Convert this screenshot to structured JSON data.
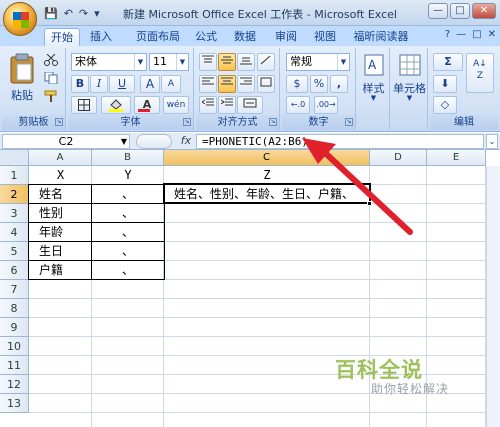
{
  "window": {
    "title": "新建 Microsoft Office Excel 工作表 - Microsoft Excel",
    "minimize": "—",
    "restore": "□",
    "close": "✕"
  },
  "qat": {
    "save": "💾",
    "undo": "↶",
    "redo": "↷",
    "customize": "▾"
  },
  "tabs": [
    "开始",
    "插入",
    "页面布局",
    "公式",
    "数据",
    "审阅",
    "视图",
    "福昕阅读器"
  ],
  "ribbon_right": {
    "help": "?",
    "min": "—",
    "restore": "□",
    "close": "✕"
  },
  "clipboard": {
    "paste": "粘贴",
    "label": "剪贴板"
  },
  "font": {
    "name": "宋体",
    "size": "11",
    "label": "字体",
    "bold": "B",
    "italic": "I",
    "underline": "U",
    "grow": "A",
    "shrink": "A",
    "phonetic": "wén"
  },
  "alignment": {
    "label": "对齐方式"
  },
  "number": {
    "format": "常规",
    "label": "数字",
    "percent": "%",
    "comma": ",",
    "currency": "$"
  },
  "styles": {
    "label": "样式"
  },
  "cells": {
    "label": "单元格"
  },
  "editing": {
    "label": "编辑",
    "sum": "Σ"
  },
  "formula_bar": {
    "name_box": "C2",
    "fx": "fx",
    "formula": "=PHONETIC(A2:B6)"
  },
  "columns": [
    "A",
    "B",
    "C",
    "D",
    "E"
  ],
  "rows": [
    "1",
    "2",
    "3",
    "4",
    "5",
    "6",
    "7",
    "8",
    "9",
    "10",
    "11",
    "12",
    "13"
  ],
  "cells_data": {
    "A1": "X",
    "B1": "Y",
    "C1": "Z",
    "A2": "姓名",
    "B2": "、",
    "A3": "性别",
    "B3": "、",
    "A4": "年龄",
    "B4": "、",
    "A5": "生日",
    "B5": "、",
    "A6": "户籍",
    "B6": "、",
    "C2": "姓名、性别、年龄、生日、户籍、"
  },
  "watermark": {
    "logo": "百科全说",
    "sub": "助你轻松解决"
  },
  "colors": {
    "ribbon": "#d3e2f5",
    "selected_header": "#f1c15f",
    "arrow": "#e0212c",
    "watermark": "#9fc05a"
  }
}
